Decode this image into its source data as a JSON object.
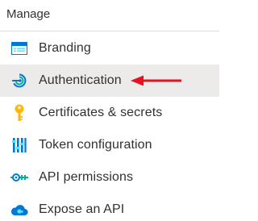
{
  "section": {
    "title": "Manage"
  },
  "nav": {
    "items": [
      {
        "label": "Branding",
        "icon": "branding-icon"
      },
      {
        "label": "Authentication",
        "icon": "authentication-icon",
        "active": true
      },
      {
        "label": "Certificates & secrets",
        "icon": "key-icon"
      },
      {
        "label": "Token configuration",
        "icon": "token-configuration-icon"
      },
      {
        "label": "API permissions",
        "icon": "api-permissions-icon"
      },
      {
        "label": "Expose an API",
        "icon": "cloud-icon"
      }
    ]
  },
  "colors": {
    "active_background": "#edebe9",
    "annotation_arrow": "#e81123",
    "icon_blue": "#0078d4",
    "icon_gold": "#ffb900",
    "icon_teal": "#00b294"
  }
}
